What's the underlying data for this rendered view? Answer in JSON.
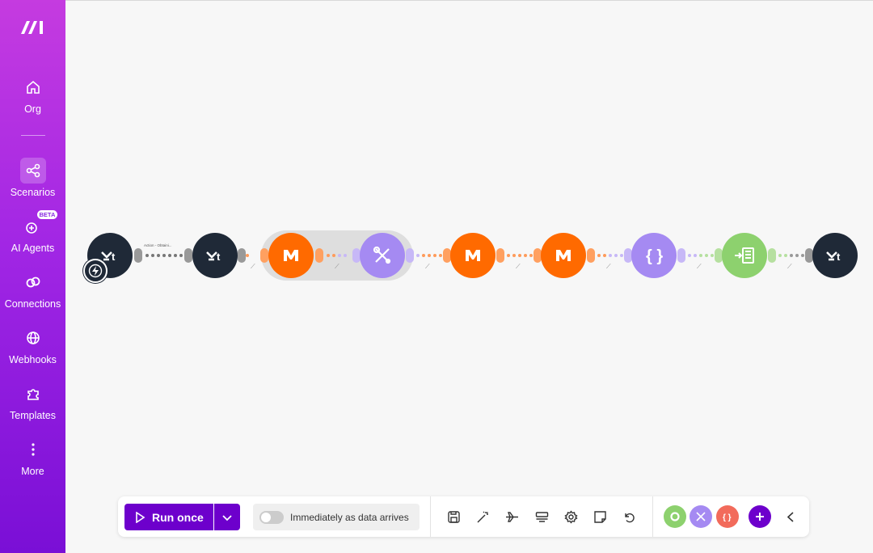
{
  "sidebar": {
    "items": [
      {
        "label": "Org",
        "icon": "home-icon"
      },
      {
        "label": "Scenarios",
        "icon": "share-icon",
        "active": true
      },
      {
        "label": "AI Agents",
        "icon": "ai-agent-icon",
        "badge": "BETA"
      },
      {
        "label": "Connections",
        "icon": "link-icon"
      },
      {
        "label": "Webhooks",
        "icon": "globe-icon"
      },
      {
        "label": "Templates",
        "icon": "puzzle-icon"
      },
      {
        "label": "More",
        "icon": "more-vertical-icon"
      }
    ]
  },
  "canvas": {
    "filter_label": "Action - Obtaini...",
    "modules": [
      {
        "app": "tally",
        "color": "#1f2937"
      },
      {
        "app": "tally",
        "color": "#1f2937"
      },
      {
        "app": "make",
        "color": "#ff6a00"
      },
      {
        "app": "tools",
        "color": "#a58af2"
      },
      {
        "app": "make",
        "color": "#ff6a00"
      },
      {
        "app": "make",
        "color": "#ff6a00"
      },
      {
        "app": "json",
        "color": "#a58af2"
      },
      {
        "app": "text-aggregator",
        "color": "#8dd16e"
      },
      {
        "app": "tally",
        "color": "#1f2937"
      }
    ]
  },
  "toolbar": {
    "run_label": "Run once",
    "schedule_label": "Immediately as data arrives",
    "tools": [
      "save-icon",
      "magic-wand-icon",
      "airplane-icon",
      "layout-icon",
      "gear-icon",
      "note-icon",
      "undo-icon"
    ],
    "favorites": [
      {
        "name": "flow-control",
        "color": "#8dd16e"
      },
      {
        "name": "tools",
        "color": "#a58af2"
      },
      {
        "name": "json",
        "color": "#f26b5b"
      }
    ],
    "add_color": "#6d00cc"
  }
}
